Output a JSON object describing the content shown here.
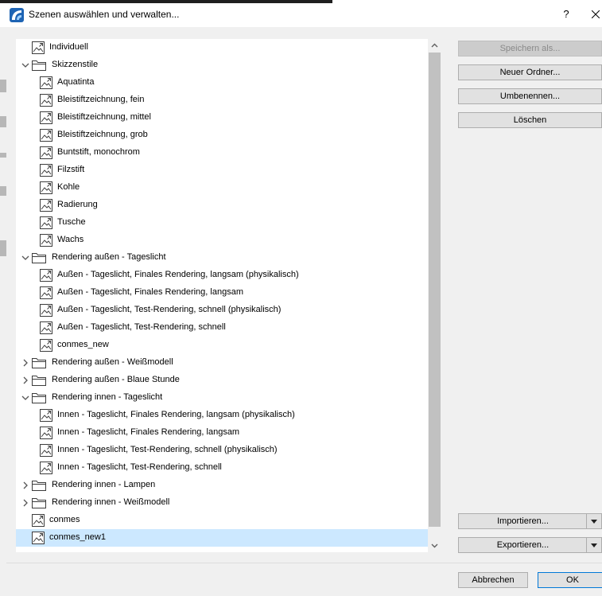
{
  "window": {
    "title": "Szenen auswählen und verwalten...",
    "help_label": "?",
    "close_label": "X"
  },
  "tree": {
    "items": [
      {
        "label": "Individuell",
        "type": "scene",
        "level": 1,
        "expander": "none"
      },
      {
        "label": "Skizzenstile",
        "type": "folder",
        "level": 1,
        "expander": "expanded"
      },
      {
        "label": "Aquatinta",
        "type": "scene",
        "level": 2,
        "expander": "none"
      },
      {
        "label": "Bleistiftzeichnung, fein",
        "type": "scene",
        "level": 2,
        "expander": "none"
      },
      {
        "label": "Bleistiftzeichnung, mittel",
        "type": "scene",
        "level": 2,
        "expander": "none"
      },
      {
        "label": "Bleistiftzeichnung, grob",
        "type": "scene",
        "level": 2,
        "expander": "none"
      },
      {
        "label": "Buntstift, monochrom",
        "type": "scene",
        "level": 2,
        "expander": "none"
      },
      {
        "label": "Filzstift",
        "type": "scene",
        "level": 2,
        "expander": "none"
      },
      {
        "label": "Kohle",
        "type": "scene",
        "level": 2,
        "expander": "none"
      },
      {
        "label": "Radierung",
        "type": "scene",
        "level": 2,
        "expander": "none"
      },
      {
        "label": "Tusche",
        "type": "scene",
        "level": 2,
        "expander": "none"
      },
      {
        "label": "Wachs",
        "type": "scene",
        "level": 2,
        "expander": "none"
      },
      {
        "label": "Rendering außen - Tageslicht",
        "type": "folder",
        "level": 1,
        "expander": "expanded"
      },
      {
        "label": "Außen - Tageslicht, Finales Rendering, langsam (physikalisch)",
        "type": "scene",
        "level": 2,
        "expander": "none"
      },
      {
        "label": "Außen - Tageslicht, Finales Rendering, langsam",
        "type": "scene",
        "level": 2,
        "expander": "none"
      },
      {
        "label": "Außen - Tageslicht, Test-Rendering, schnell (physikalisch)",
        "type": "scene",
        "level": 2,
        "expander": "none"
      },
      {
        "label": "Außen - Tageslicht, Test-Rendering, schnell",
        "type": "scene",
        "level": 2,
        "expander": "none"
      },
      {
        "label": "conmes_new",
        "type": "scene",
        "level": 2,
        "expander": "none"
      },
      {
        "label": "Rendering außen - Weißmodell",
        "type": "folder",
        "level": 1,
        "expander": "collapsed"
      },
      {
        "label": "Rendering außen - Blaue Stunde",
        "type": "folder",
        "level": 1,
        "expander": "collapsed"
      },
      {
        "label": "Rendering innen - Tageslicht",
        "type": "folder",
        "level": 1,
        "expander": "expanded"
      },
      {
        "label": "Innen - Tageslicht, Finales Rendering, langsam (physikalisch)",
        "type": "scene",
        "level": 2,
        "expander": "none"
      },
      {
        "label": "Innen - Tageslicht, Finales Rendering, langsam",
        "type": "scene",
        "level": 2,
        "expander": "none"
      },
      {
        "label": "Innen - Tageslicht, Test-Rendering, schnell (physikalisch)",
        "type": "scene",
        "level": 2,
        "expander": "none"
      },
      {
        "label": "Innen - Tageslicht, Test-Rendering, schnell",
        "type": "scene",
        "level": 2,
        "expander": "none"
      },
      {
        "label": "Rendering innen - Lampen",
        "type": "folder",
        "level": 1,
        "expander": "collapsed"
      },
      {
        "label": "Rendering innen - Weißmodell",
        "type": "folder",
        "level": 1,
        "expander": "collapsed"
      },
      {
        "label": "conmes",
        "type": "scene",
        "level": 1,
        "expander": "none"
      },
      {
        "label": "conmes_new1",
        "type": "scene",
        "level": 1,
        "expander": "none",
        "selected": true
      }
    ]
  },
  "buttons": {
    "save_as": "Speichern als...",
    "new_folder": "Neuer Ordner...",
    "rename": "Umbenennen...",
    "delete": "Löschen",
    "import": "Importieren...",
    "export": "Exportieren...",
    "cancel": "Abbrechen",
    "ok": "OK"
  },
  "colors": {
    "selection": "#cce8ff",
    "accent": "#0078d7",
    "app_icon": "#1e64b4"
  }
}
